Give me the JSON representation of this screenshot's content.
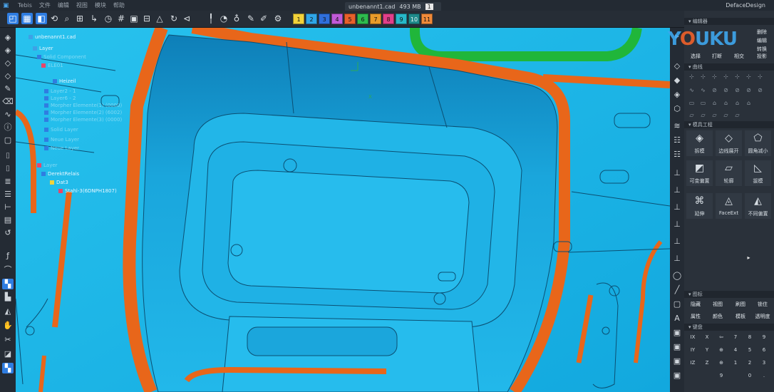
{
  "menubar": {
    "app_name": "Tebis",
    "items": [
      "文件",
      "编辑",
      "视图",
      "模块",
      "帮助"
    ],
    "file_tab": {
      "name": "unbenannt1.cad",
      "size": "493 MB",
      "number": "1"
    },
    "project": "DefaceDesign"
  },
  "toolbar": {
    "layers": [
      {
        "label": "1",
        "color": "#f2d23a"
      },
      {
        "label": "2",
        "color": "#2fa6e8"
      },
      {
        "label": "3",
        "color": "#2f6fdc"
      },
      {
        "label": "4",
        "color": "#c05ad8"
      },
      {
        "label": "5",
        "color": "#e8602a"
      },
      {
        "label": "6",
        "color": "#2dbb4e"
      },
      {
        "label": "7",
        "color": "#e89b2a"
      },
      {
        "label": "8",
        "color": "#e0408a"
      },
      {
        "label": "9",
        "color": "#27b8c9"
      },
      {
        "label": "10",
        "color": "#1f8a8a"
      },
      {
        "label": "11",
        "color": "#f08a3a"
      }
    ]
  },
  "tree": {
    "nodes": [
      {
        "label": "unbenannt1.cad",
        "dim": false
      },
      {
        "label": "Layer",
        "dim": false
      },
      {
        "label": "Solid Component",
        "dim": true
      },
      {
        "label": "ELE01",
        "dim": true
      },
      {
        "label": "Heizeil",
        "dim": false
      },
      {
        "label": "Layer2 - 1",
        "dim": true
      },
      {
        "label": "Layer6 - 2",
        "dim": true
      },
      {
        "label": "Morpher Elemente(1) (0000)",
        "dim": true
      },
      {
        "label": "Morpher Elemente(2) (6002)",
        "dim": true
      },
      {
        "label": "Morpher Elemente(3) (0000)",
        "dim": true
      },
      {
        "label": "Solid Layer",
        "dim": true
      },
      {
        "label": "Neue Layer",
        "dim": true
      },
      {
        "label": "Neue Layer",
        "dim": true
      },
      {
        "label": "Layer",
        "dim": true
      },
      {
        "label": "DerektRelais",
        "dim": false
      },
      {
        "label": "Dat3",
        "dim": false
      },
      {
        "label": "Stahl-3(6DNPH1807)",
        "dim": false
      }
    ]
  },
  "viewport": {
    "axis_label": "X"
  },
  "panel": {
    "sections": {
      "edit": "编辑器",
      "curve": "曲线",
      "mold": "模具工程",
      "layers": "图标",
      "keypad": "键盘"
    },
    "edit_buttons": [
      "删除",
      "编辑",
      "转换",
      "选择",
      "打断",
      "相交",
      "投影"
    ],
    "mold_tools": [
      {
        "label": "拆模",
        "icon": "cube-split"
      },
      {
        "label": "边线展开",
        "icon": "edge-unfold"
      },
      {
        "label": "圆角减小",
        "icon": "fillet"
      },
      {
        "label": "可变偏置",
        "icon": "variable-offset"
      },
      {
        "label": "轮廓",
        "icon": "profile"
      },
      {
        "label": "拔模",
        "icon": "draft"
      },
      {
        "label": "延伸",
        "icon": "extend"
      },
      {
        "label": "FaceExt",
        "icon": "face-ext"
      },
      {
        "label": "不同偏置",
        "icon": "diff-offset"
      }
    ],
    "layer_buttons": [
      "隐藏",
      "视图",
      "刷图",
      "锁住",
      "属性",
      "颜色",
      "模板",
      "透明度"
    ],
    "keypad_keys": [
      "IX",
      "X",
      "⇦",
      "7",
      "8",
      "9",
      "IY",
      "Y",
      "⊕",
      "4",
      "5",
      "6",
      "IZ",
      "Z",
      "⊕",
      "1",
      "2",
      "3",
      "",
      "",
      "9",
      "",
      "0",
      "."
    ]
  },
  "watermark": {
    "text": "YOUKU"
  }
}
